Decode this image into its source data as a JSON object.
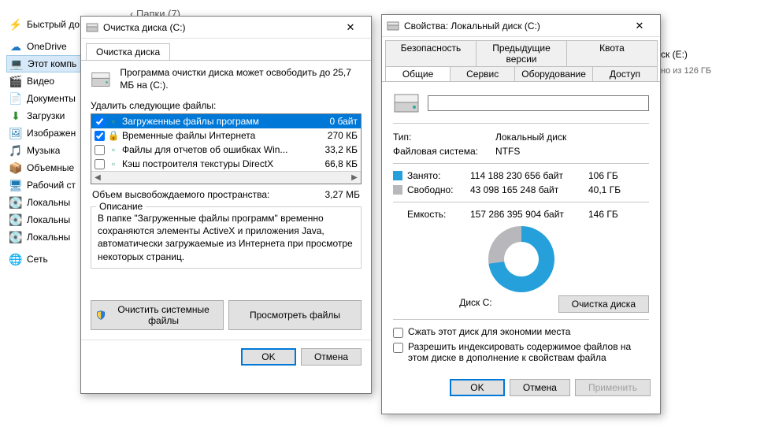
{
  "explorer": {
    "breadcrumb": "‹ Папки (7)",
    "sidebar": [
      {
        "icon": "⚡",
        "label": "Быстрый до"
      },
      {
        "icon": "☁",
        "label": "OneDrive",
        "color": "#2079c5"
      },
      {
        "icon": "💻",
        "label": "Этот компь",
        "selected": true,
        "color": "#3a7ab8"
      },
      {
        "icon": "🎬",
        "label": "Видео",
        "color": "#5b5b5b"
      },
      {
        "icon": "📄",
        "label": "Документы",
        "color": "#5b5b5b"
      },
      {
        "icon": "⬇",
        "label": "Загрузки",
        "color": "#2e8b2e"
      },
      {
        "icon": "🖼",
        "label": "Изображен",
        "color": "#1e7ab3"
      },
      {
        "icon": "🎵",
        "label": "Музыка",
        "color": "#1ea0d0"
      },
      {
        "icon": "📦",
        "label": "Объемные",
        "color": "#1e7ab3"
      },
      {
        "icon": "🖥",
        "label": "Рабочий ст",
        "color": "#1e7ab3"
      },
      {
        "icon": "💽",
        "label": "Локальны",
        "color": "#6a6a6a"
      },
      {
        "icon": "💽",
        "label": "Локальны",
        "color": "#6a6a6a"
      },
      {
        "icon": "💽",
        "label": "Локальны",
        "color": "#6a6a6a"
      },
      {
        "icon": "🌐",
        "label": "Сеть",
        "color": "#2079c5"
      }
    ],
    "drive_label": "ск (E:)",
    "drive_sub": "но из 126 ГБ"
  },
  "cleanup": {
    "title": "Очистка диска  (C:)",
    "tab": "Очистка диска",
    "summary": "Программа очистки диска может освободить до 25,7 МБ на  (C:).",
    "files_label": "Удалить следующие файлы:",
    "rows": [
      {
        "checked": true,
        "icon": "📥",
        "name": "Загруженные файлы программ",
        "size": "0 байт",
        "selected": true
      },
      {
        "checked": true,
        "icon": "🔒",
        "name": "Временные файлы Интернета",
        "size": "270 КБ",
        "lock": true
      },
      {
        "checked": false,
        "icon": "📄",
        "name": "Файлы для отчетов об ошибках Win...",
        "size": "33,2 КБ"
      },
      {
        "checked": false,
        "icon": "📄",
        "name": "Кэш построителя текстуры DirectX",
        "size": "66,8 КБ"
      }
    ],
    "total_label": "Объем высвобождаемого пространства:",
    "total_value": "3,27 МБ",
    "desc_title": "Описание",
    "desc_text": "В папке \"Загруженные файлы программ\" временно сохраняются элементы ActiveX и приложения Java, автоматически загружаемые из Интернета при просмотре некоторых страниц.",
    "btn_sys": "Очистить системные файлы",
    "btn_view": "Просмотреть файлы",
    "ok": "OK",
    "cancel": "Отмена"
  },
  "props": {
    "title": "Свойства: Локальный диск (C:)",
    "tabs_top": [
      "Безопасность",
      "Предыдущие версии",
      "Квота"
    ],
    "tabs_bot": [
      "Общие",
      "Сервис",
      "Оборудование",
      "Доступ"
    ],
    "active_tab": "Общие",
    "type_label": "Тип:",
    "type_val": "Локальный диск",
    "fs_label": "Файловая система:",
    "fs_val": "NTFS",
    "used_label": "Занято:",
    "used_bytes": "114 188 230 656 байт",
    "used_gb": "106 ГБ",
    "free_label": "Свободно:",
    "free_bytes": "43 098 165 248 байт",
    "free_gb": "40,1 ГБ",
    "cap_label": "Емкость:",
    "cap_bytes": "157 286 395 904 байт",
    "cap_gb": "146 ГБ",
    "pie_label": "Диск C:",
    "btn_cleanup": "Очистка диска",
    "chk_compress": "Сжать этот диск для экономии места",
    "chk_index": "Разрешить индексировать содержимое файлов на этом диске в дополнение к свойствам файла",
    "ok": "OK",
    "cancel": "Отмена",
    "apply": "Применить"
  },
  "colors": {
    "used": "#26a0da",
    "free": "#b8b8bc"
  }
}
